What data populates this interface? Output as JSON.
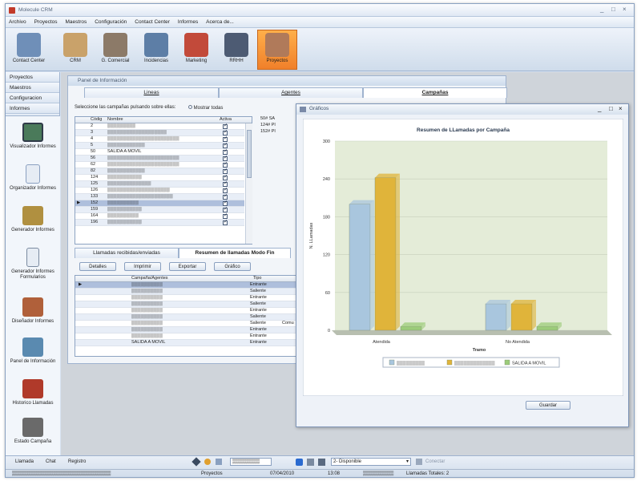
{
  "app": {
    "title": "Molecule CRM",
    "window_buttons": [
      "_",
      "□",
      "×"
    ]
  },
  "menu": [
    "Archivo",
    "Proyectos",
    "Maestros",
    "Configuración",
    "Contact Center",
    "Informes",
    "Acerca de..."
  ],
  "toolbar": [
    {
      "label": "Contact Center",
      "icon": "phone-server-icon",
      "color": "#6f8fb8"
    },
    {
      "label": "CRM",
      "icon": "people-icon",
      "color": "#c9a26a"
    },
    {
      "label": "G. Comercial",
      "icon": "salesman-icon",
      "color": "#8c7a68"
    },
    {
      "label": "Incidencias",
      "icon": "truck-icon",
      "color": "#5d7ea6"
    },
    {
      "label": "Marketing",
      "icon": "presentation-icon",
      "color": "#c24a3a"
    },
    {
      "label": "RRHH",
      "icon": "staff-icon",
      "color": "#4d5b73"
    },
    {
      "label": "Proyectos",
      "icon": "boxes-icon",
      "color": "#b07a5a",
      "active": true
    }
  ],
  "sidebar": {
    "sections": [
      "Proyectos",
      "Maestros",
      "Configuracion",
      "Informes"
    ],
    "items": [
      {
        "label": "Visualizador Informes",
        "icon": "monitor-icon",
        "color": "#4a7a5a"
      },
      {
        "label": "Organizador Informes",
        "icon": "document-icon",
        "color": "#8aa0c0"
      },
      {
        "label": "Generador Informes",
        "icon": "report-generator-icon",
        "color": "#b09040"
      },
      {
        "label": "Generador Informes Formularios",
        "icon": "form-icon",
        "color": "#9aa6b6"
      },
      {
        "label": "Diseñador Informes",
        "icon": "designer-icon",
        "color": "#b0603a"
      },
      {
        "label": "Panel de Información",
        "icon": "info-panel-icon",
        "color": "#5a8ab0"
      },
      {
        "label": "Historico Llamadas",
        "icon": "book-icon",
        "color": "#b03a2a"
      },
      {
        "label": "Estado Campaña",
        "icon": "camera-icon",
        "color": "#6a6a6a"
      }
    ]
  },
  "panel": {
    "title": "Panel de Información",
    "tabs": [
      "Lineas",
      "Agentes",
      "Campañas"
    ],
    "instruction": "Seleccione las campañas pulsando sobre ellas:",
    "show_all": "Mostrar todas",
    "grid_headers": [
      "Códig",
      "Nombre",
      "Activa"
    ],
    "campaigns": [
      {
        "code": "2",
        "name": "▒▒▒▒▒▒▒▒▒"
      },
      {
        "code": "3",
        "name": "▒▒▒▒▒▒▒▒▒▒▒▒▒▒▒▒▒▒▒"
      },
      {
        "code": "4",
        "name": "▒▒▒▒▒▒▒▒▒▒▒▒▒▒▒▒▒▒▒▒▒▒▒"
      },
      {
        "code": "5",
        "name": "▒▒▒▒▒▒▒▒▒▒▒▒"
      },
      {
        "code": "50",
        "name": "SALIDA A MOVIL"
      },
      {
        "code": "56",
        "name": "▒▒▒▒▒▒▒▒▒▒▒▒▒▒▒▒▒▒▒▒▒▒▒"
      },
      {
        "code": "62",
        "name": "▒▒▒▒▒▒▒▒▒▒▒▒▒▒▒▒▒▒▒▒▒▒▒"
      },
      {
        "code": "82",
        "name": "▒▒▒▒▒▒▒▒▒▒▒▒"
      },
      {
        "code": "124",
        "name": "▒▒▒▒▒▒▒▒▒▒▒"
      },
      {
        "code": "125",
        "name": "▒▒▒▒▒▒▒▒▒▒▒▒▒▒"
      },
      {
        "code": "126",
        "name": "▒▒▒▒▒▒▒▒▒▒▒▒▒▒▒▒▒▒▒▒"
      },
      {
        "code": "133",
        "name": "▒▒▒▒▒▒▒▒▒▒▒▒▒▒▒▒▒▒▒▒▒"
      },
      {
        "code": "152",
        "name": "▒▒▒▒▒▒▒▒▒▒"
      },
      {
        "code": "159",
        "name": "▒▒▒▒▒▒▒▒▒▒▒"
      },
      {
        "code": "164",
        "name": "▒▒▒▒▒▒▒▒▒▒"
      },
      {
        "code": "196",
        "name": "▒▒▒▒▒▒▒▒▒▒▒"
      }
    ],
    "side_list": [
      "50#",
      "124#",
      "152#"
    ],
    "side_list_cols": [
      "SA",
      "Pl",
      "Pl"
    ],
    "lower_tabs": [
      "Llamadas recibidas/enviadas",
      "Resumen de llamadas Modo Fin"
    ],
    "buttons": [
      "Detalles",
      "Imprimir",
      "Exportar",
      "Gráfico"
    ],
    "lower_headers": [
      "Campaña/Agentes",
      "Tipo"
    ],
    "lower_rows": [
      {
        "name": "▒▒▒▒▒▒▒▒▒▒",
        "tipo": "Entrante"
      },
      {
        "name": "▒▒▒▒▒▒▒▒▒▒",
        "tipo": "Saliente"
      },
      {
        "name": "▒▒▒▒▒▒▒▒▒▒",
        "tipo": "Entrante"
      },
      {
        "name": "▒▒▒▒▒▒▒▒▒▒",
        "tipo": "Saliente"
      },
      {
        "name": "▒▒▒▒▒▒▒▒▒▒",
        "tipo": "Entrante"
      },
      {
        "name": "▒▒▒▒▒▒▒▒▒▒",
        "tipo": "Saliente"
      },
      {
        "name": "▒▒▒▒▒▒▒▒▒▒",
        "tipo": "Saliente"
      },
      {
        "name": "▒▒▒▒▒▒▒▒▒▒",
        "tipo": "Entrante"
      },
      {
        "name": "▒▒▒▒▒▒▒▒▒▒",
        "tipo": "Entrante"
      },
      {
        "name": "SALIDA A MOVIL",
        "tipo": "Entrante"
      }
    ],
    "extra_col": [
      "",
      "",
      "",
      "",
      "",
      "",
      "Comu",
      "",
      "",
      ""
    ]
  },
  "graficos": {
    "title": "Gráficos",
    "save": "Guardar"
  },
  "chart_data": {
    "type": "bar",
    "title": "Resumen de LLamadas por Campaña",
    "xlabel": "Tramo",
    "ylabel": "N. LLamadas",
    "categories": [
      "Atendida",
      "No Atendida"
    ],
    "series": [
      {
        "name": "▒▒▒▒▒▒▒▒▒",
        "values": [
          200,
          42
        ],
        "color": "#a9c6de"
      },
      {
        "name": "▒▒▒▒▒▒▒▒▒▒▒▒▒",
        "values": [
          242,
          42
        ],
        "color": "#e0b43a"
      },
      {
        "name": "SALIDA A MOVIL",
        "values": [
          6,
          6
        ],
        "color": "#9ccc7a"
      }
    ],
    "yticks": [
      0,
      60,
      120,
      180,
      240,
      300
    ],
    "ylim": [
      0,
      300
    ],
    "grid": true,
    "legend": "bottom"
  },
  "statusbar": {
    "tabs": [
      "Llamada",
      "Chat",
      "Registro"
    ],
    "phone_field": "▒▒▒▒▒▒▒▒",
    "status_select": "2- Disponible",
    "connect": "Conectar",
    "cells": [
      "▒▒▒▒▒▒▒▒▒▒▒▒▒▒▒▒▒▒▒▒▒▒▒▒▒▒▒▒▒",
      "Proyectos",
      "07/04/2010",
      "13:08",
      "▒▒▒▒▒▒▒▒▒",
      "Llamadas Totales: 2"
    ]
  }
}
